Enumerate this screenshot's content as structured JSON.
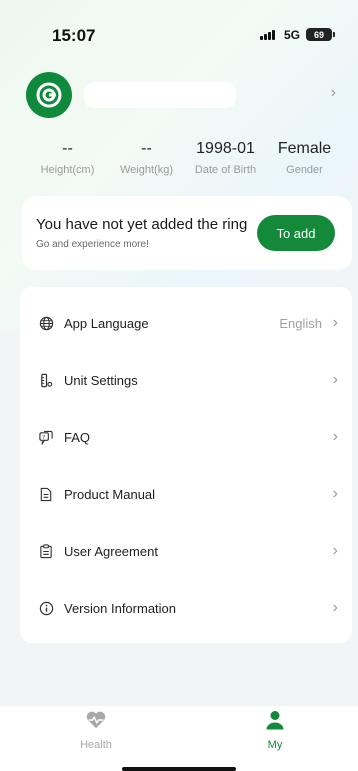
{
  "status_bar": {
    "time": "15:07",
    "network": "5G",
    "battery": "69"
  },
  "profile": {
    "avatar_icon": "brand-logo-icon",
    "chevron": "›"
  },
  "stats": [
    {
      "value": "--",
      "label": "Height(cm)"
    },
    {
      "value": "--",
      "label": "Weight(kg)"
    },
    {
      "value": "1998-01",
      "label": "Date of Birth"
    },
    {
      "value": "Female",
      "label": "Gender"
    }
  ],
  "ring_card": {
    "title": "You have not yet added the ring",
    "subtitle": "Go and experience more!",
    "button": "To add"
  },
  "menu": [
    {
      "icon": "globe-icon",
      "label": "App Language",
      "value": "English"
    },
    {
      "icon": "ruler-icon",
      "label": "Unit Settings",
      "value": ""
    },
    {
      "icon": "faq-icon",
      "label": "FAQ",
      "value": ""
    },
    {
      "icon": "document-icon",
      "label": "Product Manual",
      "value": ""
    },
    {
      "icon": "clipboard-icon",
      "label": "User Agreement",
      "value": ""
    },
    {
      "icon": "info-icon",
      "label": "Version Information",
      "value": ""
    }
  ],
  "tabs": [
    {
      "icon": "heart-pulse-icon",
      "label": "Health",
      "active": false
    },
    {
      "icon": "person-icon",
      "label": "My",
      "active": true
    }
  ],
  "colors": {
    "accent": "#14893a",
    "inactive": "#a8a8a8"
  }
}
